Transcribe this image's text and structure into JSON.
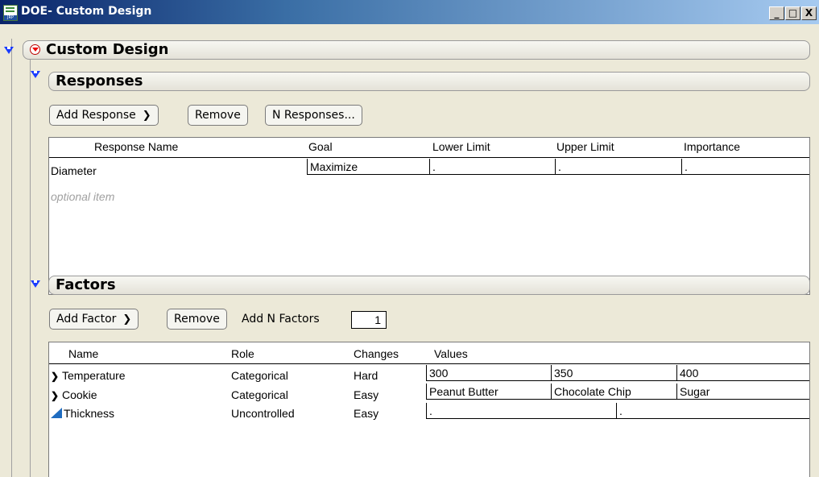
{
  "window": {
    "title": "DOE- Custom Design",
    "icon_label": "JRP",
    "controls": {
      "minimize": "_",
      "maximize": "□",
      "close": "X"
    }
  },
  "custom_design": {
    "title": "Custom Design"
  },
  "responses": {
    "title": "Responses",
    "buttons": {
      "add_response": "Add Response",
      "remove": "Remove",
      "n_responses": "N Responses..."
    },
    "columns": [
      "Response Name",
      "Goal",
      "Lower Limit",
      "Upper Limit",
      "Importance"
    ],
    "rows": [
      {
        "name": "Diameter",
        "goal": "Maximize",
        "lower": ".",
        "upper": ".",
        "importance": "."
      }
    ],
    "optional_text": "optional item"
  },
  "factors": {
    "title": "Factors",
    "buttons": {
      "add_factor": "Add Factor",
      "remove": "Remove",
      "add_n_factors": "Add N Factors"
    },
    "n_factors_value": "1",
    "columns": [
      "Name",
      "Role",
      "Changes",
      "Values"
    ],
    "rows": [
      {
        "icon": "chevron-down-icon",
        "name": "Temperature",
        "role": "Categorical",
        "changes": "Hard",
        "values": [
          "300",
          "350",
          "400"
        ]
      },
      {
        "icon": "chevron-down-icon",
        "name": "Cookie",
        "role": "Categorical",
        "changes": "Easy",
        "values": [
          "Peanut Butter",
          "Chocolate Chip",
          "Sugar"
        ]
      },
      {
        "icon": "continuous-ramp-icon",
        "name": "Thickness",
        "role": "Uncontrolled",
        "changes": "Easy",
        "values": [
          ".",
          "."
        ]
      }
    ]
  },
  "colors": {
    "disclosure": "#1a3cff",
    "red_menu": "#e00000",
    "ramp": "#1f6cc0",
    "title_start": "#0a246a",
    "title_end": "#a6caf0"
  }
}
